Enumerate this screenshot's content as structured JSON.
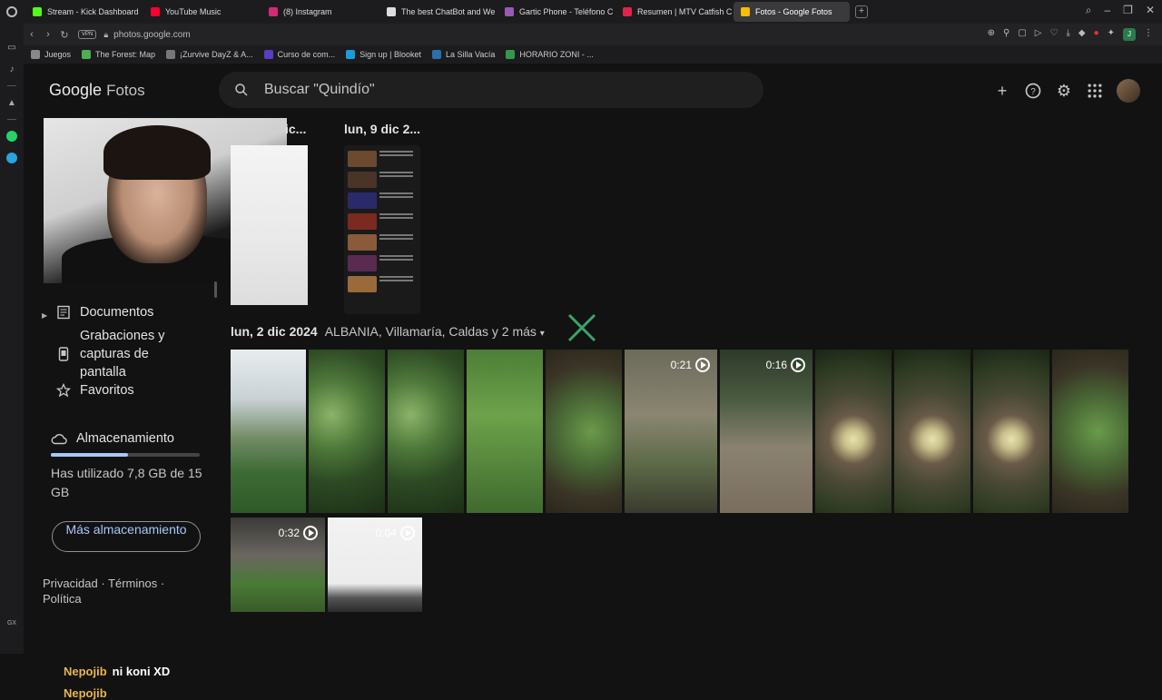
{
  "browser": {
    "tabs": [
      {
        "label": "Stream - Kick Dashboard",
        "color": "#53fc18"
      },
      {
        "label": "YouTube Music",
        "color": "#ff0033"
      },
      {
        "label": "(8) Instagram",
        "color": "#d62976"
      },
      {
        "label": "The best ChatBot and We",
        "color": "#dddddd"
      },
      {
        "label": "Gartic Phone - Teléfono C",
        "color": "#9b59b6"
      },
      {
        "label": "Resumen | MTV Catfish C",
        "color": "#e0244a"
      },
      {
        "label": "Fotos - Google Fotos",
        "color": "#fbbc04",
        "active": true
      }
    ],
    "url": "photos.google.com",
    "vpn_label": "VPN",
    "profile_initial": "J",
    "bookmarks": [
      {
        "label": "Juegos",
        "color": "#888888"
      },
      {
        "label": "The Forest: Map",
        "color": "#4caf50"
      },
      {
        "label": "¡Zurvive DayZ & A...",
        "color": "#777777"
      },
      {
        "label": "Curso de com...",
        "color": "#5b3cc4"
      },
      {
        "label": "Sign up | Blooket",
        "color": "#1a9dd9"
      },
      {
        "label": "La Silla Vacía",
        "color": "#2a6fb0"
      },
      {
        "label": "HORARIO ZONI - ...",
        "color": "#2e9a4a"
      }
    ],
    "rail_bottom_label": "GX"
  },
  "header": {
    "logo_google": "Google",
    "logo_fotos": "Fotos",
    "search_placeholder": "Buscar \"Quindío\""
  },
  "sidebar": {
    "nav_items": [
      {
        "label": "Documentos",
        "icon": "document-icon",
        "has_caret": true
      },
      {
        "label": "Grabaciones y capturas de pantalla",
        "icon": "phone-screenshot-icon"
      },
      {
        "label": "Favoritos",
        "icon": "star-icon"
      }
    ],
    "storage": {
      "title": "Almacenamiento",
      "used_text": "Has utilizado 7,8 GB de 15 GB",
      "used_fraction": 0.52,
      "more_button": "Más almacenamiento"
    },
    "legal": {
      "privacy": "Privacidad",
      "terms": "Términos",
      "policy": "Política"
    }
  },
  "content": {
    "section1_date_partial": "ic...",
    "section2_date": "lun, 9 dic 2...",
    "section3_date": "lun, 2 dic 2024",
    "section3_location": "ALBANIA, Villamaría, Caldas y 2 más",
    "row1": [
      {
        "kind": "sky"
      },
      {
        "kind": "plants"
      },
      {
        "kind": "plants"
      },
      {
        "kind": "grass"
      },
      {
        "kind": "leaves"
      },
      {
        "kind": "ground",
        "duration": "0:21"
      },
      {
        "kind": "path",
        "duration": "0:16"
      },
      {
        "kind": "mushroom"
      },
      {
        "kind": "mushroom"
      },
      {
        "kind": "mushroom"
      },
      {
        "kind": "leaves"
      }
    ],
    "row2": [
      {
        "kind": "feet",
        "duration": "0:32"
      },
      {
        "kind": "selfie",
        "duration": "0:04"
      }
    ]
  },
  "stream_chat": {
    "line1_nick": "Nepojib",
    "line1_msg": "ni koni XD",
    "line2_nick": "Nepojib"
  }
}
